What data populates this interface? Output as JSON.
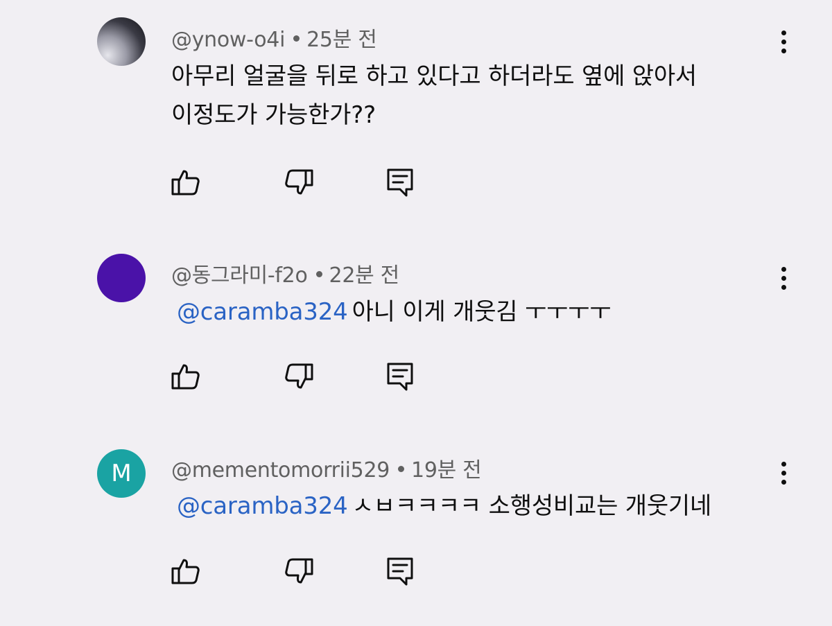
{
  "comments": [
    {
      "author": "@ynow-o4i",
      "time": "25분 전",
      "mention": "",
      "text_line1": "아무리 얼굴을 뒤로 하고 있다고 하더라도 옆에 앉아서",
      "text_line2": "이정도가 가능한가??",
      "avatar": {
        "type": "gradient",
        "letter": ""
      }
    },
    {
      "author": "@동그라미-f2o",
      "time": "22분 전",
      "mention": "@caramba324",
      "text_line1": "아니 이게 개웃김 ㅜㅜㅜㅜ",
      "avatar": {
        "type": "solid",
        "color": "#4a12a8",
        "letter": ""
      }
    },
    {
      "author": "@mementomorrii529",
      "time": "19분 전",
      "mention": "@caramba324",
      "text_line1": "ㅅㅂㅋㅋㅋㅋ 소행성비교는 개웃기네",
      "avatar": {
        "type": "solid",
        "color": "#1aa3a3",
        "letter": "M"
      }
    }
  ],
  "icons": {
    "like": "thumbs-up-icon",
    "dislike": "thumbs-down-icon",
    "reply": "reply-icon",
    "menu": "more-vert-icon"
  },
  "colors": {
    "background": "#f1eff3",
    "mention": "#2a63c4",
    "meta": "#606060",
    "text": "#0f0f0f"
  }
}
